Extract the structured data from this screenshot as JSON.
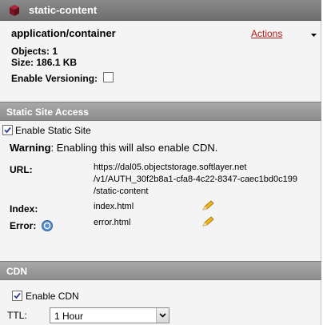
{
  "header": {
    "container_name": "static-content"
  },
  "container": {
    "type": "application/container",
    "actions_label": "Actions",
    "objects_label": "Objects:",
    "objects_value": "1",
    "size_label": "Size:",
    "size_value": "186.1 KB",
    "versioning_label": "Enable Versioning:",
    "versioning_checked": false
  },
  "static_site": {
    "section_title": "Static Site Access",
    "enable_label": "Enable Static Site",
    "enable_checked": true,
    "warning_label": "Warning",
    "warning_text": ": Enabling this will also enable CDN.",
    "url_label": "URL:",
    "url_line1": "https://dal05.objectstorage.softlayer.net",
    "url_line2": "/v1/AUTH_30f2b8a1-cfa8-4c22-8347-caec1bd0c199",
    "url_line3": "/static-content",
    "index_label": "Index:",
    "index_value": "index.html",
    "error_label": "Error:",
    "error_value": "error.html"
  },
  "cdn": {
    "section_title": "CDN",
    "enable_label": "Enable CDN",
    "enable_checked": true,
    "ttl_label": "TTL:",
    "ttl_value": "1 Hour"
  },
  "icons": {
    "container": "cube-icon",
    "edit": "pencil-icon",
    "help": "help-icon",
    "dropdown": "chevron-down-icon"
  },
  "colors": {
    "header_dark": "#787878",
    "section_header": "#9a9a9a",
    "link": "#b01c1c",
    "container_icon": "#8b1a2b"
  }
}
